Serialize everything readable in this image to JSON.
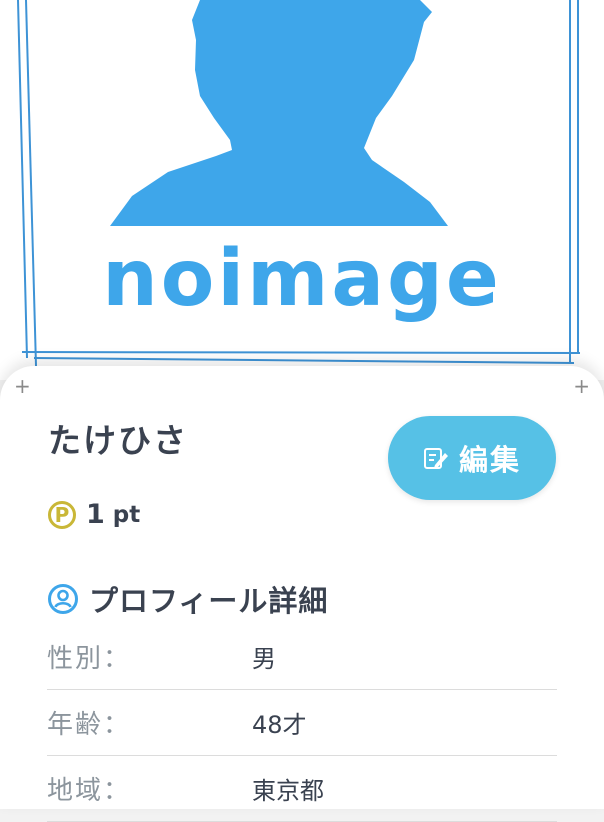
{
  "hero": {
    "placeholder_text": "noimage",
    "accent_color": "#3ea6ea"
  },
  "profile": {
    "username": "たけひさ",
    "edit_button_label": "編集",
    "points_value": "1",
    "points_unit": "pt",
    "points_badge": "P"
  },
  "details": {
    "section_title": "プロフィール詳細",
    "rows": [
      {
        "label": "性別：",
        "value": "男"
      },
      {
        "label": "年齢：",
        "value": "48才"
      },
      {
        "label": "地域：",
        "value": "東京都"
      }
    ]
  },
  "icons": [
    "edit-icon",
    "points-icon",
    "profile-user-icon",
    "plus-icon"
  ],
  "colors": {
    "button": "#56c1e6",
    "text_dark": "#3a4250",
    "text_muted": "#8c959d",
    "points_gold": "#c9b737"
  }
}
